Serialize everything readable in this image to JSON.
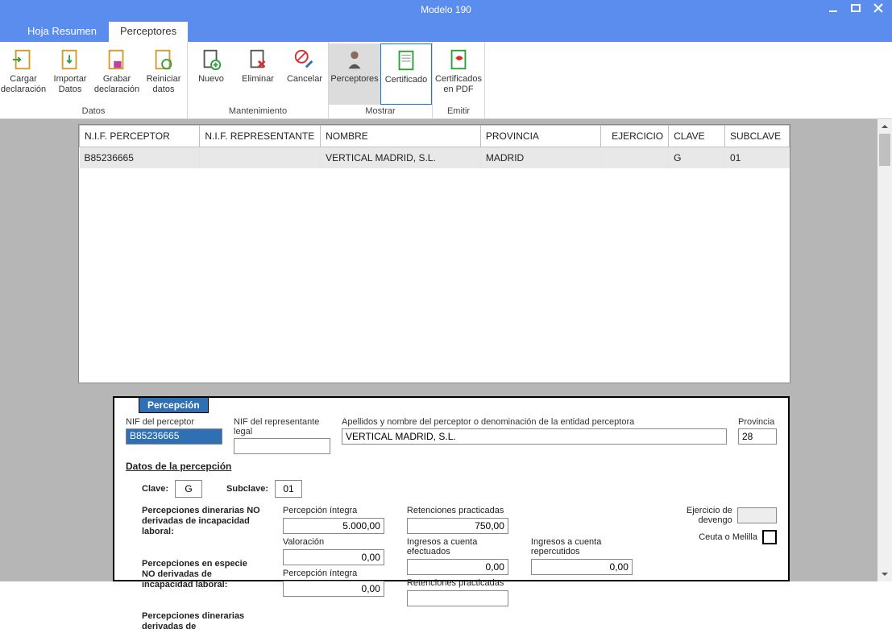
{
  "window": {
    "title": "Modelo 190"
  },
  "tabs": {
    "resumen": "Hoja Resumen",
    "perceptores": "Perceptores"
  },
  "ribbon": {
    "datos": {
      "label": "Datos",
      "cargar": "Cargar declaración",
      "importar": "Importar Datos",
      "grabar": "Grabar declaración",
      "reiniciar": "Reiniciar datos"
    },
    "mant": {
      "label": "Mantenimiento",
      "nuevo": "Nuevo",
      "eliminar": "Eliminar",
      "cancelar": "Cancelar"
    },
    "mostrar": {
      "label": "Mostrar",
      "perceptores": "Perceptores",
      "certificado": "Certificado"
    },
    "emitir": {
      "label": "Emitir",
      "certpdf": "Certificados en PDF"
    }
  },
  "grid": {
    "headers": {
      "nif": "N.I.F. PERCEPTOR",
      "nifr": "N.I.F. REPRESENTANTE",
      "nombre": "NOMBRE",
      "prov": "PROVINCIA",
      "ejer": "EJERCICIO",
      "clave": "CLAVE",
      "sub": "SUBCLAVE"
    },
    "rows": [
      {
        "nif": "B85236665",
        "nifr": "",
        "nombre": "VERTICAL MADRID, S.L.",
        "prov": "MADRID",
        "ejer": "",
        "clave": "G",
        "sub": "01"
      }
    ]
  },
  "form": {
    "section": "Percepción",
    "lbl_nif": "NIF del perceptor",
    "lbl_nifr": "NIF del representante legal",
    "lbl_nombre": "Apellidos y nombre del perceptor o denominación de la entidad perceptora",
    "lbl_prov": "Provincia",
    "val_nif": "B85236665",
    "val_nifr": "",
    "val_nombre": "VERTICAL MADRID, S.L.",
    "val_prov": "28",
    "datos_h": "Datos de la percepción",
    "lbl_clave": "Clave:",
    "val_clave": "G",
    "lbl_subclave": "Subclave:",
    "val_subclave": "01",
    "pl1": "Percepciones dinerarias NO derivadas de incapacidad laboral:",
    "pl2": "Percepciones en especie NO derivadas de incapacidad laboral:",
    "pl3": "Percepciones dinerarias derivadas de",
    "col_pi": "Percepción íntegra",
    "val_pi1": "5.000,00",
    "col_rp": "Retenciones practicadas",
    "val_rp1": "750,00",
    "col_val": "Valoración",
    "val_val": "0,00",
    "col_ice": "Ingresos a cuenta efectuados",
    "val_ice": "0,00",
    "col_icr": "Ingresos a cuenta repercutidos",
    "val_icr": "0,00",
    "val_pi2": "0,00",
    "val_rp2": "",
    "lbl_ej": "Ejercicio de devengo",
    "lbl_cm": "Ceuta o Melilla"
  }
}
